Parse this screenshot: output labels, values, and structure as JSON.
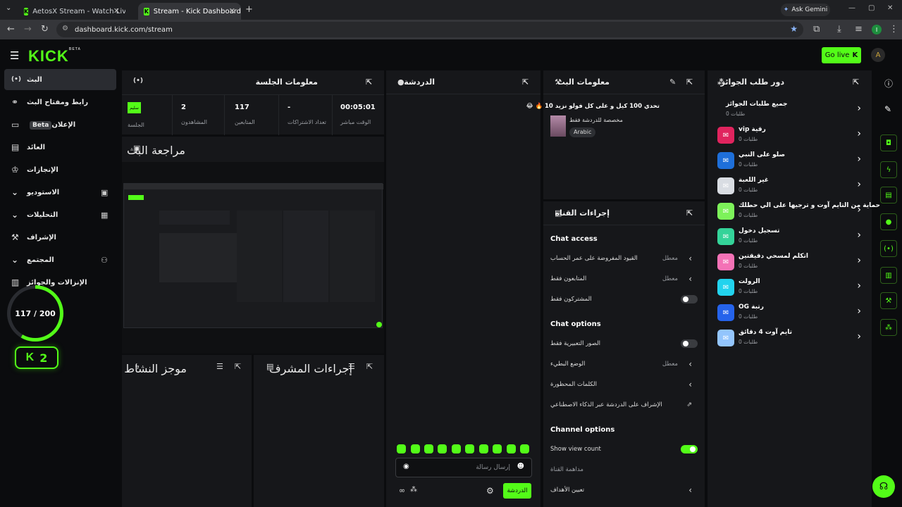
{
  "browser": {
    "tabs": [
      {
        "title": "AetosX Stream - Watch Live on",
        "active": false
      },
      {
        "title": "Stream - Kick Dashboard",
        "active": true
      }
    ],
    "url": "dashboard.kick.com/stream",
    "ask_gemini": "Ask Gemini",
    "profile_initial": "I"
  },
  "header": {
    "logo": "KICK",
    "logo_tag": "BETA",
    "go_live": "Go live",
    "avatar_initial": "A"
  },
  "nav": {
    "items": [
      {
        "label": "البث",
        "icon": "(•)"
      },
      {
        "label": "رابط ومفتاح البث",
        "icon": "⚙"
      },
      {
        "label": "الإعلان",
        "icon": "▭",
        "badge": "Beta"
      },
      {
        "label": "العائد",
        "icon": "▤"
      },
      {
        "label": "الإنجازات",
        "icon": "🏆"
      },
      {
        "label": "الاستوديو",
        "icon": "▣"
      },
      {
        "label": "التحليلات",
        "icon": "▦"
      },
      {
        "label": "الإشراف",
        "icon": "🔧"
      },
      {
        "label": "المجتمع",
        "icon": "👥"
      },
      {
        "label": "الإنزالات والجوائز",
        "icon": "▥"
      }
    ],
    "progress_text": "117 / 200",
    "progress_fraction": 0.585,
    "level": "2"
  },
  "session": {
    "title": "معلومات الجلسة",
    "stats": [
      {
        "value": "00:05:01",
        "label": "الوقت مباشر"
      },
      {
        "value": "-",
        "label": "تعداد الاشتراكات"
      },
      {
        "value": "117",
        "label": "المتابعين"
      },
      {
        "value": "2",
        "label": "المشاهدون"
      }
    ],
    "session_badge": "سليم",
    "session_label": "الجلسة"
  },
  "preview": {
    "title": "مراجعة البث"
  },
  "activity": {
    "title": "موجز النشاط"
  },
  "mod_actions": {
    "title": "إجراءات المشرف"
  },
  "chat": {
    "title": "الدردشة",
    "placeholder": "إرسال رسالة",
    "send": "الدردشة"
  },
  "stream_info": {
    "title": "معلومات البث",
    "stream_title": "تحدي 100 كيل و على كل فولو نزيد 10 🔥 😂",
    "category": "مخصصة للدردشة فقط",
    "language": "Arabic"
  },
  "channel_actions": {
    "title": "إجراءات القناة",
    "chat_access": "Chat access",
    "rows_access": [
      {
        "label": "القيود المفروضة على عمر الحساب",
        "value": "معطل",
        "type": "chevron"
      },
      {
        "label": "المتابعون فقط",
        "value": "معطل",
        "type": "chevron"
      },
      {
        "label": "المشتركون فقط",
        "value": "",
        "type": "toggle",
        "on": false
      }
    ],
    "chat_options": "Chat options",
    "rows_options": [
      {
        "label": "الصور التعبيرية فقط",
        "value": "",
        "type": "toggle",
        "on": false
      },
      {
        "label": "الوضع البطيء",
        "value": "معطل",
        "type": "chevron"
      },
      {
        "label": "الكلمات المحظورة",
        "value": "",
        "type": "chevron"
      },
      {
        "label": "الإشراف على الدردشة عبر الذكاء الاصطناعي",
        "value": "",
        "type": "external"
      }
    ],
    "channel_options": "Channel options",
    "rows_channel": [
      {
        "label": "Show view count",
        "value": "",
        "type": "toggle",
        "on": true
      },
      {
        "label": "مداهمة القناة",
        "value": "",
        "type": "none"
      },
      {
        "label": "تعيين الأهداف",
        "value": "",
        "type": "chevron"
      }
    ]
  },
  "rewards": {
    "title": "دور طلب الجوائز",
    "all_label": "جميع طلبات الجوائز",
    "all_count": "طلبات 0",
    "items": [
      {
        "name": "رقية vip",
        "count": "طلبات 0",
        "color": "#e0245e"
      },
      {
        "name": "صلو على النبي",
        "count": "طلبات 0",
        "color": "#1e6fd9"
      },
      {
        "name": "غير اللعبة",
        "count": "طلبات 0",
        "color": "#d9dde3"
      },
      {
        "name": "حماية من التايم آوت و ترجيها على الي حطلك",
        "count": "طلبات 0",
        "color": "#7df25a"
      },
      {
        "name": "تسجيل دخول",
        "count": "طلبات 0",
        "color": "#34d399"
      },
      {
        "name": "اتكلم لمسحي دقيقتين",
        "count": "طلبات 0",
        "color": "#f472b6"
      },
      {
        "name": "الرولت",
        "count": "طلبات 0",
        "color": "#22d3ee"
      },
      {
        "name": "رتبة OG",
        "count": "طلبات 0",
        "color": "#2563eb"
      },
      {
        "name": "تايم آوت 4 دقائق",
        "count": "طلبات 0",
        "color": "#93c5fd"
      }
    ]
  }
}
